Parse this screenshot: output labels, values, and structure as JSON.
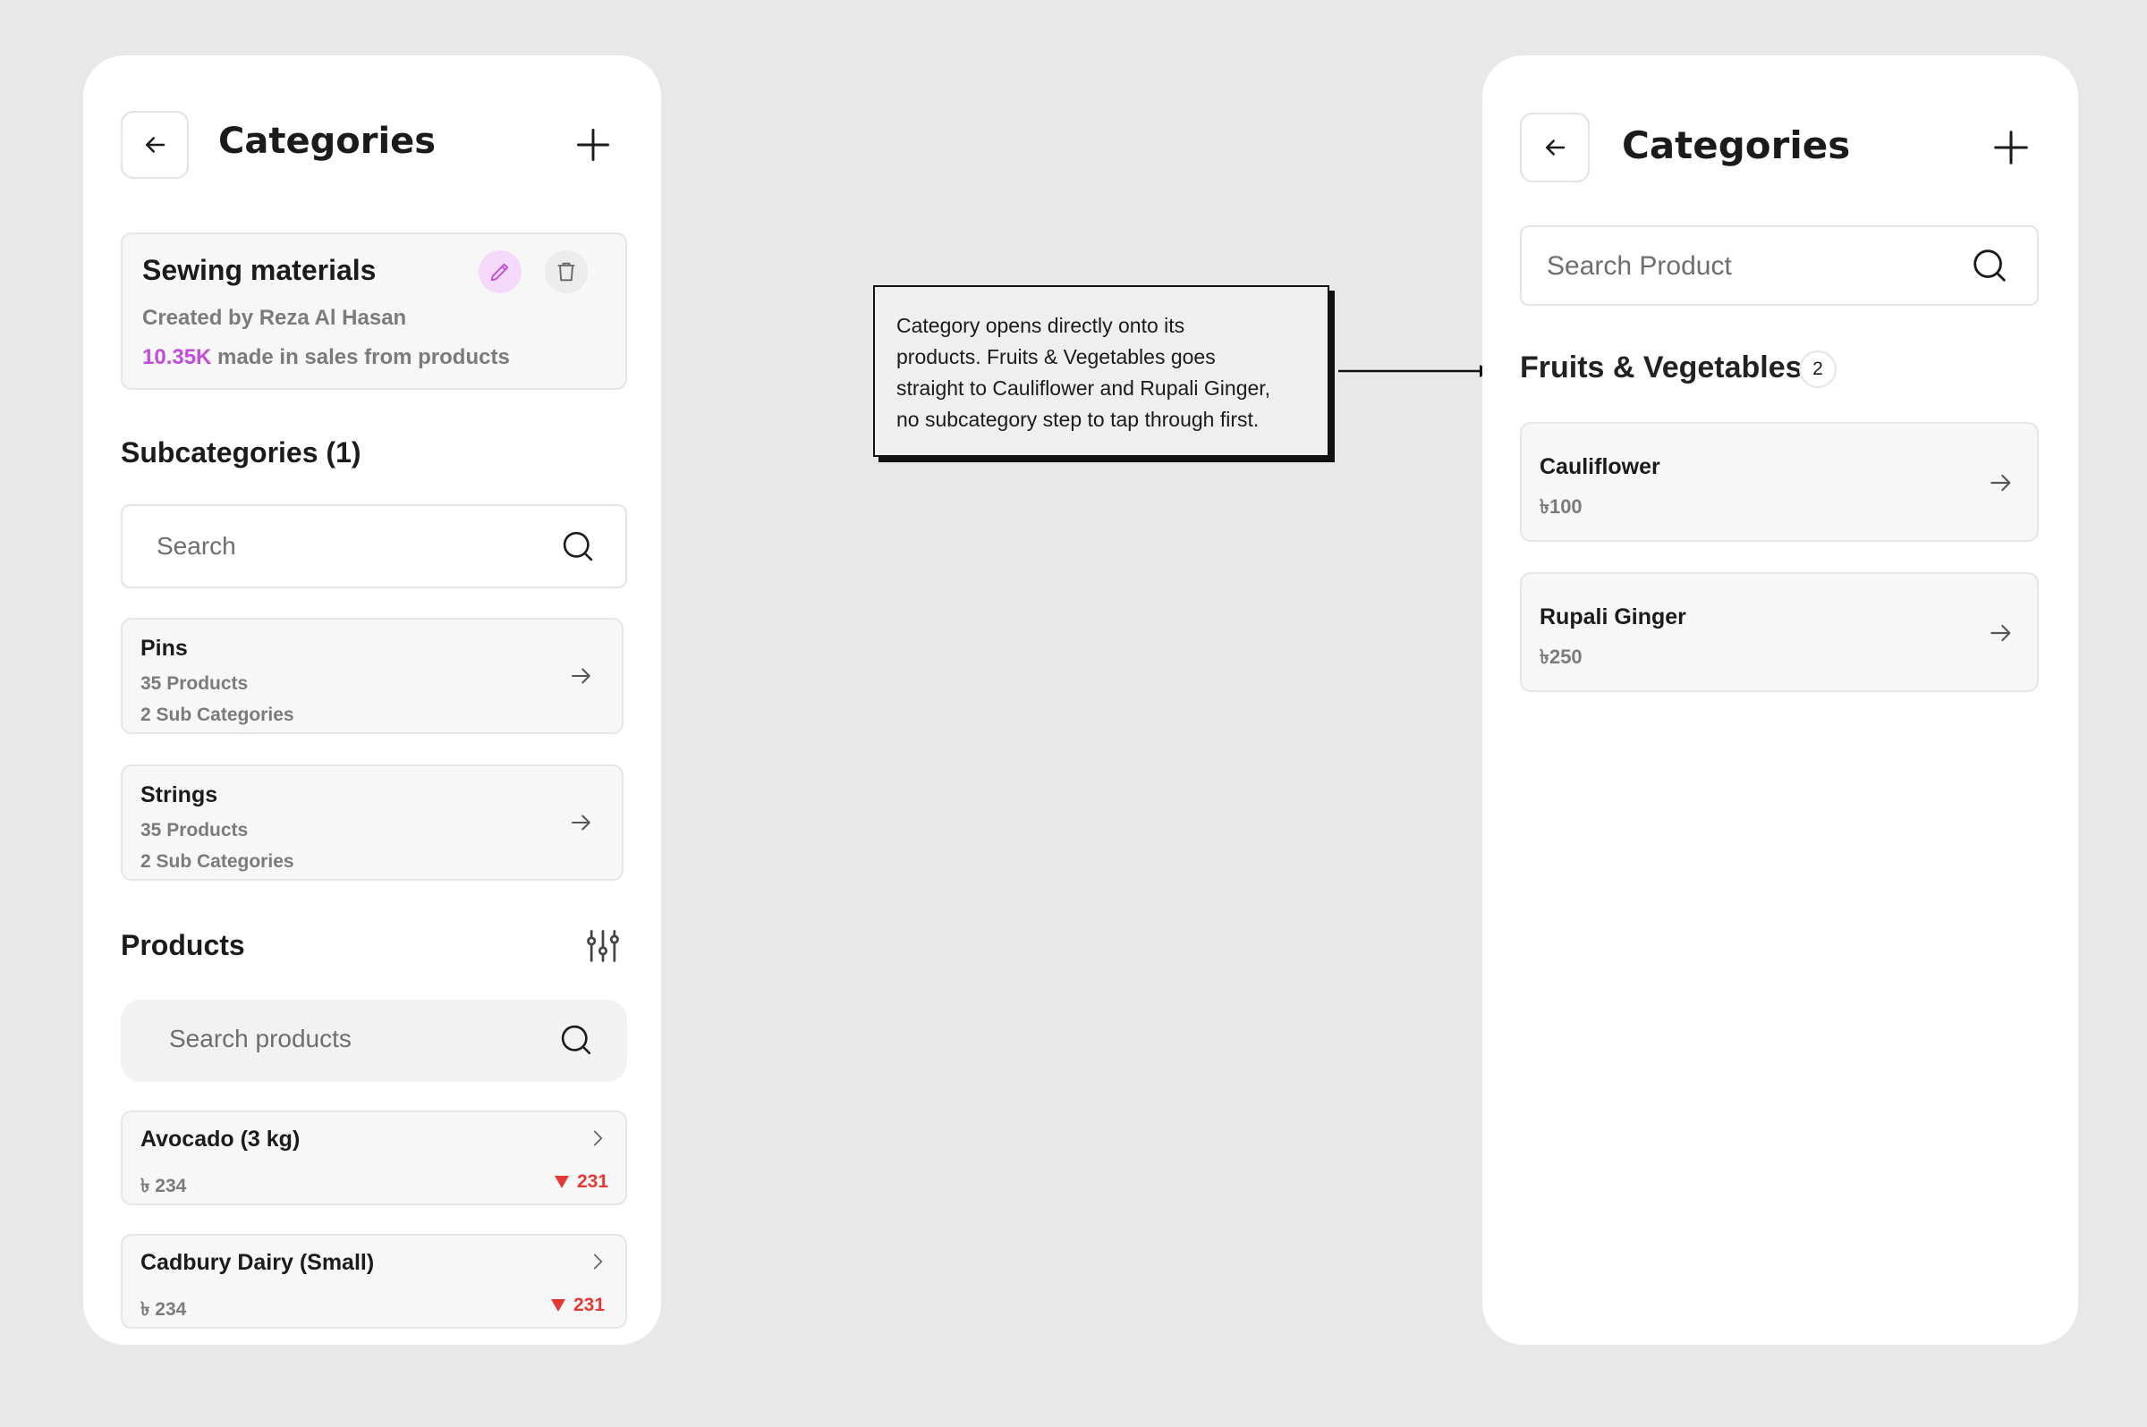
{
  "left": {
    "header": {
      "title": "Categories"
    },
    "category": {
      "name": "Sewing materials",
      "created_by": "Created by Reza Al Hasan",
      "sales_value": "10.35K",
      "sales_suffix": " made in sales from products"
    },
    "subcategories": {
      "heading": "Subcategories (1)",
      "search_placeholder": "Search",
      "items": [
        {
          "name": "Pins",
          "products": "35 Products",
          "subcats": "2 Sub Categories"
        },
        {
          "name": "Strings",
          "products": "35 Products",
          "subcats": "2 Sub Categories"
        }
      ]
    },
    "products": {
      "heading": "Products",
      "search_placeholder": "Search products",
      "items": [
        {
          "name": "Avocado (3 kg)",
          "price": "৳ 234",
          "change": "231"
        },
        {
          "name": "Cadbury Dairy (Small)",
          "price": "৳ 234",
          "change": "231"
        }
      ]
    }
  },
  "annotation": {
    "line1": "Category opens directly onto its",
    "line2": "products. Fruits & Vegetables goes",
    "line3": "straight to Cauliflower and Rupali Ginger,",
    "line4": "no subcategory step to tap through first."
  },
  "right": {
    "header": {
      "title": "Categories"
    },
    "search_placeholder": "Search Product",
    "group": {
      "name": "Fruits & Vegetables",
      "count": "2"
    },
    "items": [
      {
        "name": "Cauliflower",
        "price": "৳100"
      },
      {
        "name": "Rupali Ginger",
        "price": "৳250"
      }
    ]
  },
  "colors": {
    "accent": "#c24ddb",
    "down": "#e53935",
    "background": "#e8e8e8"
  }
}
